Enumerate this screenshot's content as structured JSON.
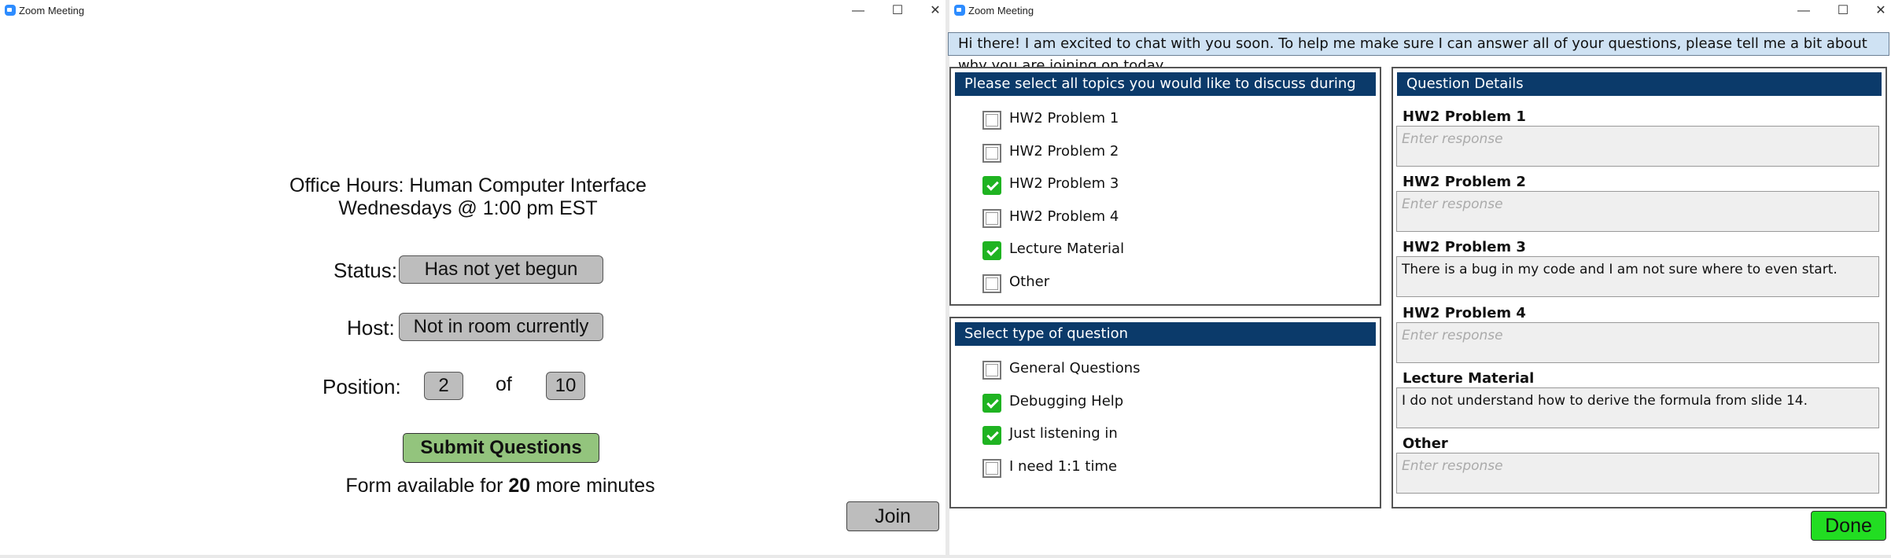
{
  "left_window": {
    "title": "Zoom Meeting",
    "controls": {
      "minimize": "—",
      "maximize": "☐",
      "close": "✕"
    },
    "heading_line1": "Office Hours: Human Computer Interface",
    "heading_line2": "Wednesdays @ 1:00 pm EST",
    "status_label": "Status:",
    "status_value": "Has not yet begun",
    "host_label": "Host:",
    "host_value": "Not in room currently",
    "position_label": "Position:",
    "position_value": "2",
    "position_of": "of",
    "position_total": "10",
    "submit_label": "Submit Questions",
    "form_prefix": "Form available for",
    "form_minutes": "20",
    "form_suffix": "more minutes",
    "join_label": "Join"
  },
  "right_window": {
    "title": "Zoom Meeting",
    "controls": {
      "minimize": "—",
      "maximize": "☐",
      "close": "✕"
    },
    "banner": "Hi there! I am excited to chat with you soon. To help me make sure I can answer all of your questions, please tell me a bit about why you are joining on today.",
    "topics": {
      "header": "Please select all topics you would like to discuss during office hours",
      "items": [
        {
          "label": "HW2 Problem 1",
          "checked": false
        },
        {
          "label": "HW2 Problem 2",
          "checked": false
        },
        {
          "label": "HW2 Problem 3",
          "checked": true
        },
        {
          "label": "HW2 Problem 4",
          "checked": false
        },
        {
          "label": "Lecture Material",
          "checked": true
        },
        {
          "label": "Other",
          "checked": false
        }
      ]
    },
    "question_types": {
      "header": "Select type of question",
      "items": [
        {
          "label": "General Questions",
          "checked": false
        },
        {
          "label": "Debugging Help",
          "checked": true
        },
        {
          "label": "Just listening in",
          "checked": true
        },
        {
          "label": "I need 1:1 time",
          "checked": false
        }
      ]
    },
    "details": {
      "header": "Question Details",
      "items": [
        {
          "title": "HW2 Problem 1",
          "value": "",
          "placeholder": "Enter response"
        },
        {
          "title": "HW2 Problem 2",
          "value": "",
          "placeholder": "Enter response"
        },
        {
          "title": "HW2 Problem 3",
          "value": "There is a bug in my code and I am not sure where to even start.",
          "placeholder": "Enter response"
        },
        {
          "title": "HW2 Problem 4",
          "value": "",
          "placeholder": "Enter response"
        },
        {
          "title": "Lecture Material",
          "value": "I do not understand how to derive the formula from slide 14.",
          "placeholder": "Enter response"
        },
        {
          "title": "Other",
          "value": "",
          "placeholder": "Enter response"
        }
      ]
    },
    "done_label": "Done"
  }
}
